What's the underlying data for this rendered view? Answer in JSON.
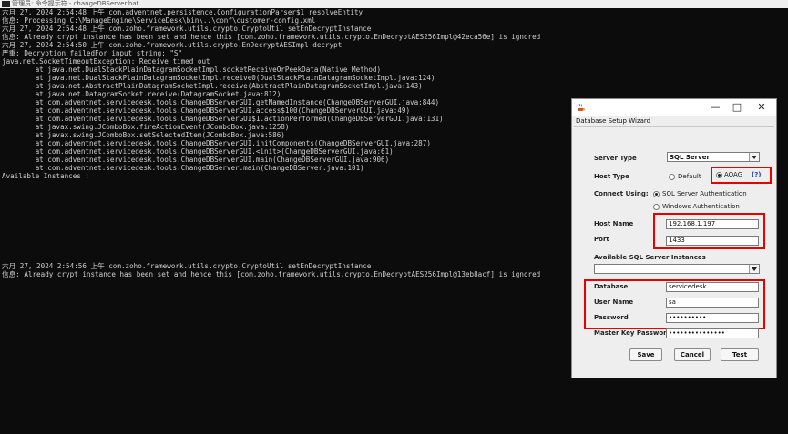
{
  "window": {
    "title": "管理员: 命令提示符 - changeDBServer.bat"
  },
  "console": {
    "lines": [
      "六月 27, 2024 2:54:48 上午 com.adventnet.persistence.ConfigurationParser$1 resolveEntity",
      "信息: Processing C:\\ManageEngine\\ServiceDesk\\bin\\..\\conf\\customer-config.xml",
      "六月 27, 2024 2:54:48 上午 com.zoho.framework.utils.crypto.CryptoUtil setEnDecryptInstance",
      "信息: Already crypt instance has been set and hence this [com.zoho.framework.utils.crypto.EnDecryptAES256Impl@42eca56e] is ignored",
      "六月 27, 2024 2:54:50 上午 com.zoho.framework.utils.crypto.EnDecryptAESImpl decrypt",
      "严重: Decryption failedFor input string: \"S\"",
      "java.net.SocketTimeoutException: Receive timed out",
      "        at java.net.DualStackPlainDatagramSocketImpl.socketReceiveOrPeekData(Native Method)",
      "        at java.net.DualStackPlainDatagramSocketImpl.receive0(DualStackPlainDatagramSocketImpl.java:124)",
      "        at java.net.AbstractPlainDatagramSocketImpl.receive(AbstractPlainDatagramSocketImpl.java:143)",
      "        at java.net.DatagramSocket.receive(DatagramSocket.java:812)",
      "        at com.adventnet.servicedesk.tools.ChangeDBServerGUI.getNamedInstance(ChangeDBServerGUI.java:844)",
      "        at com.adventnet.servicedesk.tools.ChangeDBServerGUI.access$100(ChangeDBServerGUI.java:49)",
      "        at com.adventnet.servicedesk.tools.ChangeDBServerGUI$1.actionPerformed(ChangeDBServerGUI.java:131)",
      "        at javax.swing.JComboBox.fireActionEvent(JComboBox.java:1258)",
      "        at javax.swing.JComboBox.setSelectedItem(JComboBox.java:586)",
      "        at com.adventnet.servicedesk.tools.ChangeDBServerGUI.initComponents(ChangeDBServerGUI.java:287)",
      "        at com.adventnet.servicedesk.tools.ChangeDBServerGUI.<init>(ChangeDBServerGUI.java:61)",
      "        at com.adventnet.servicedesk.tools.ChangeDBServerGUI.main(ChangeDBServerGUI.java:906)",
      "        at com.adventnet.servicedesk.tools.ChangeDBServer.main(ChangeDBServer.java:101)",
      "Available Instances :",
      "",
      "",
      "",
      "",
      "",
      "",
      "",
      "",
      "",
      "",
      "六月 27, 2024 2:54:56 上午 com.zoho.framework.utils.crypto.CryptoUtil setEnDecryptInstance",
      "信息: Already crypt instance has been set and hence this [com.zoho.framework.utils.crypto.EnDecryptAES256Impl@13eb8acf] is ignored"
    ]
  },
  "dialog": {
    "subtitle": "Database Setup Wizard",
    "controls": {
      "minimize": "—",
      "maximize": "□",
      "close": "✕"
    },
    "server_type_label": "Server Type",
    "server_type_value": "SQL Server",
    "host_type_label": "Host Type",
    "host_type_default": "Default",
    "host_type_aoag": "AOAG",
    "help_text": "(?)",
    "connect_using_label": "Connect Using:",
    "auth_sql": "SQL Server Authentication",
    "auth_windows": "Windows Authentication",
    "host_name_label": "Host Name",
    "host_name_value": "192.168.1.197",
    "port_label": "Port",
    "port_value": "1433",
    "instances_label": "Available SQL Server Instances",
    "instances_value": "",
    "database_label": "Database",
    "database_value": "servicedesk",
    "username_label": "User Name",
    "username_value": "sa",
    "password_label": "Password",
    "password_value": "••••••••••",
    "master_key_label": "Master Key Password",
    "master_key_value": "•••••••••••••••",
    "save_label": "Save",
    "cancel_label": "Cancel",
    "test_label": "Test"
  },
  "colors": {
    "highlight": "#e60000",
    "console_bg": "#0c0c0c",
    "console_text": "#cfcfcf"
  },
  "icons": {
    "window": "cmd-icon",
    "dialog": "java-icon"
  }
}
